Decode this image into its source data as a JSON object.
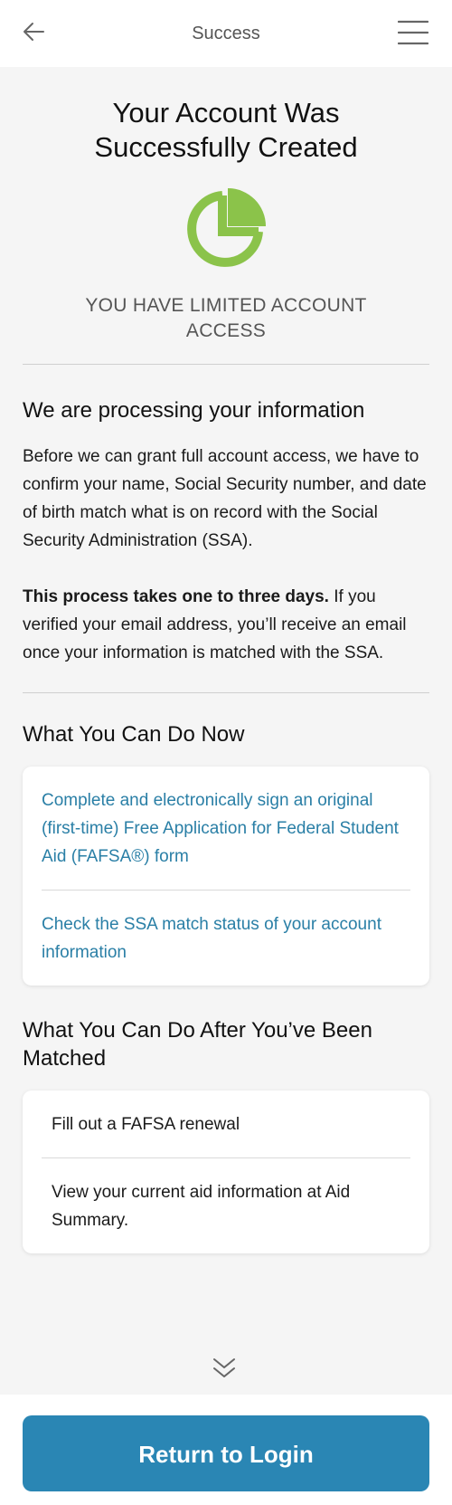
{
  "header": {
    "title": "Success",
    "back_icon": "arrow-left-icon",
    "menu_icon": "hamburger-menu-icon"
  },
  "main": {
    "title": "Your Account Was Successfully Created",
    "status_icon": "pie-chart-icon",
    "status_color": "#8bc34a",
    "status_text": "YOU HAVE LIMITED ACCOUNT ACCESS",
    "processing": {
      "heading": "We are processing your information",
      "paragraph1": "Before we can grant full account access, we have to confirm your name, Social Security number, and date of birth match what is on record with the Social Security Administration (SSA).",
      "paragraph2_bold": "This process takes one to three days.",
      "paragraph2_rest": " If you verified your email address, you’ll receive an email once your information is matched with the SSA."
    },
    "can_do_now": {
      "heading": "What You Can Do Now",
      "items": [
        "Complete and electronically sign an original (first-time) Free Application for Federal Student Aid (FAFSA®) form",
        "Check the SSA match status of your account information"
      ]
    },
    "after_matched": {
      "heading": "What You Can Do After You’ve Been Matched",
      "items": [
        "Fill out a FAFSA renewal",
        "View your current aid information at Aid Summary."
      ]
    }
  },
  "scroll_icon": "double-chevron-down-icon",
  "footer": {
    "button_label": "Return to Login",
    "button_color": "#2a86b4"
  },
  "colors": {
    "link": "#2a7fa6",
    "background": "#f5f5f5"
  }
}
